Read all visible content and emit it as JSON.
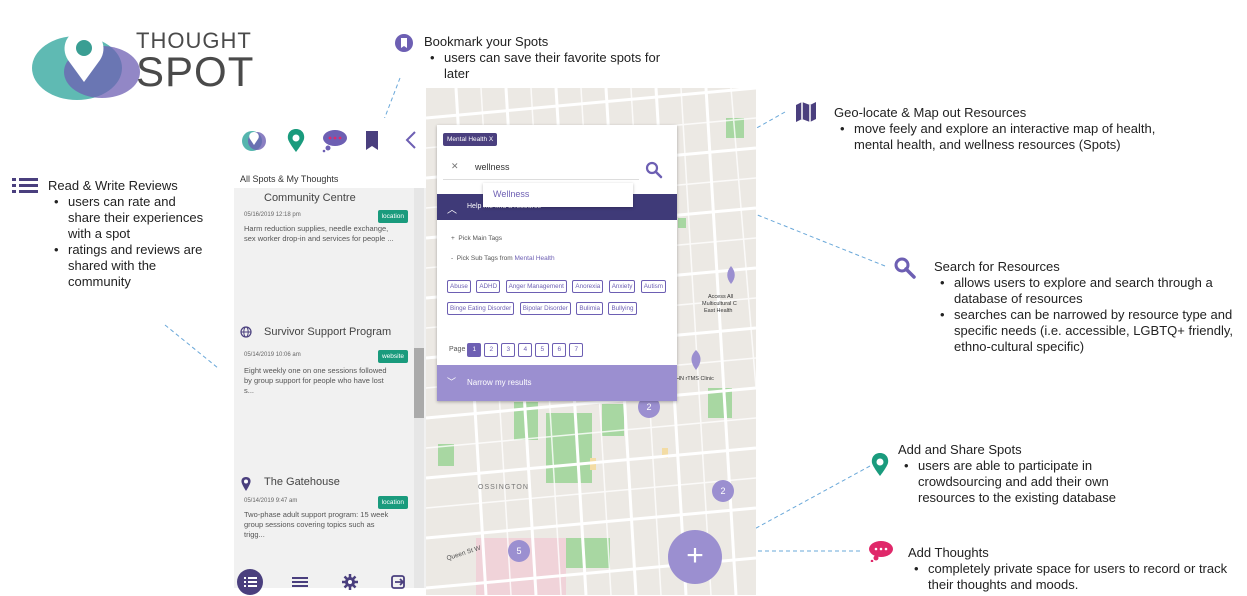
{
  "logo": {
    "line1": "THOUGHT",
    "line2": "SPOT"
  },
  "notes": {
    "bookmark": {
      "title": "Bookmark your Spots",
      "items": [
        "users can save their favorite spots for later"
      ]
    },
    "geolocate": {
      "title": "Geo-locate & Map out Resources",
      "items": [
        "move feely and explore an interactive map of health, mental health, and wellness resources (Spots)"
      ]
    },
    "reviews": {
      "title": "Read & Write Reviews",
      "items": [
        "users can rate and share their experiences with a spot",
        "ratings and reviews are shared with the community"
      ]
    },
    "search": {
      "title": "Search for Resources",
      "items": [
        "allows users to explore and search through a database of resources",
        "searches can be narrowed by resource type and specific needs (i.e. accessible, LGBTQ+ friendly, ethno-cultural specific)"
      ]
    },
    "addspots": {
      "title": "Add and Share Spots",
      "items": [
        "users are able to participate in crowdsourcing and add their own resources to the existing database"
      ]
    },
    "thoughts": {
      "title": "Add Thoughts",
      "items": [
        "completely private space for users to record or track their thoughts and moods."
      ]
    }
  },
  "app": {
    "list_header": "All Spots & My Thoughts",
    "cards": [
      {
        "title": "Community Centre",
        "date": "05/16/2019 12:18 pm",
        "badge": "location",
        "desc": "Harm reduction supplies, needle exchange, sex worker drop-in and services for people ..."
      },
      {
        "title": "Survivor Support Program",
        "date": "05/14/2019 10:06 am",
        "badge": "website",
        "desc": "Eight weekly one on one sessions followed by group support for people who have lost s..."
      },
      {
        "title": "The Gatehouse",
        "date": "05/14/2019 9:47 am",
        "badge": "location",
        "desc": "Two-phase adult support program: 15 week group sessions covering topics such as trigg..."
      }
    ]
  },
  "search": {
    "pill": "Mental Health X",
    "input_value": "wellness",
    "suggestion": "Wellness",
    "bar_text": "Help me find a resource",
    "main_tags": "Pick Main Tags",
    "sub_tags_prefix": "Pick Sub Tags from",
    "sub_tags_category": "Mental Health",
    "tags": [
      "Abuse",
      "ADHD",
      "Anger Management",
      "Anorexia",
      "Anxiety",
      "Autism",
      "Binge Eating Disorder",
      "Bipolar Disorder",
      "Bulimia",
      "Bullying"
    ],
    "page_label": "Page",
    "pages": [
      "1",
      "2",
      "3",
      "4",
      "5",
      "6",
      "7"
    ],
    "narrow": "Narrow my results"
  },
  "map": {
    "labels": {
      "ossington": "OSSINGTON",
      "queen": "Queen St W",
      "access": "Access All",
      "multicultural": "Multicultural C",
      "easthealth": "East Health",
      "clinic": "HN rTMS Clinic"
    },
    "clusters": [
      "2",
      "2",
      "5"
    ]
  },
  "colors": {
    "brand_purple": "#6d5fb3",
    "teal": "#1a9b7d",
    "pink": "#e0286a"
  }
}
